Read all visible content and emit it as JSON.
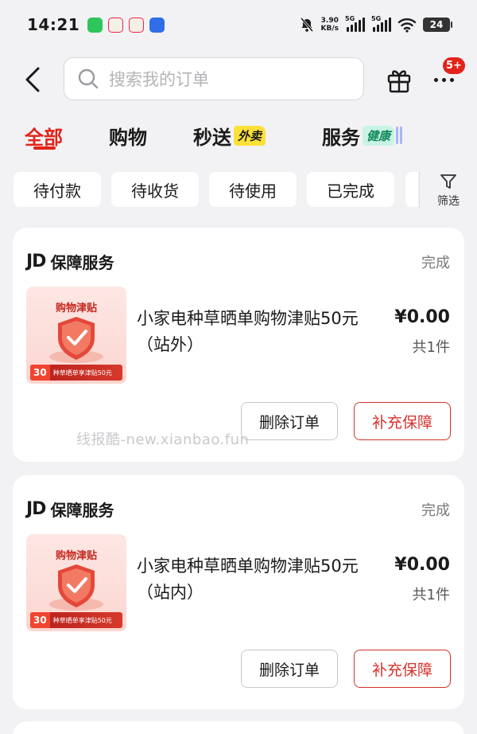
{
  "status_bar": {
    "time": "14:21",
    "net_speed_value": "3.90",
    "net_speed_unit": "KB/s",
    "sim1": "5G",
    "sim2": "5G",
    "battery": "24",
    "app_icons": [
      "wechat-icon",
      "app-icon",
      "app-icon",
      "app-icon"
    ]
  },
  "header": {
    "search_placeholder": "搜索我的订单",
    "badge": "5+"
  },
  "tabs": [
    {
      "label": "全部",
      "active": true
    },
    {
      "label": "购物",
      "active": false
    },
    {
      "label": "秒送",
      "tag": "外卖",
      "active": false
    },
    {
      "label": "服务",
      "tag": "健康",
      "active": false
    }
  ],
  "filters": [
    "待付款",
    "待收货",
    "待使用",
    "已完成"
  ],
  "filter_button": "筛选",
  "orders": [
    {
      "logo": "JD",
      "shop": "保障服务",
      "status": "完成",
      "thumb_title": "购物津贴",
      "thumb_num": "30",
      "thumb_ribbon": "种草晒单享津贴50元",
      "title": "小家电种草晒单购物津贴50元（站外）",
      "price": "¥0.00",
      "qty": "共1件",
      "btn_delete": "删除订单",
      "btn_insure": "补充保障"
    },
    {
      "logo": "JD",
      "shop": "保障服务",
      "status": "完成",
      "thumb_title": "购物津贴",
      "thumb_num": "30",
      "thumb_ribbon": "种草晒单享津贴50元",
      "title": "小家电种草晒单购物津贴50元（站内）",
      "price": "¥0.00",
      "qty": "共1件",
      "btn_delete": "删除订单",
      "btn_insure": "补充保障"
    }
  ],
  "watermark": "线报酷-new.xianbao.fun",
  "colors": {
    "accent": "#e2231a",
    "background": "#f2f2f5",
    "tag_yellow": "#fde13a",
    "tag_green": "#c9f3e4"
  }
}
